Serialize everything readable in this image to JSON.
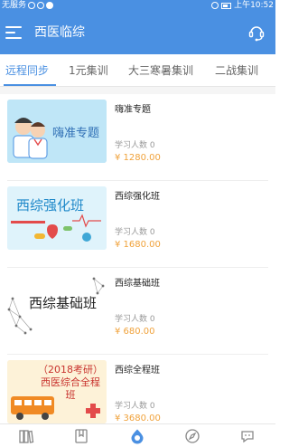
{
  "status_bar": {
    "carrier": "无服务",
    "time": "上午10:52"
  },
  "header": {
    "title": "西医临综"
  },
  "tabs": [
    {
      "label": "远程同步",
      "active": true
    },
    {
      "label": "1元集训",
      "active": false
    },
    {
      "label": "大三寒暑集训",
      "active": false
    },
    {
      "label": "二战集训",
      "active": false
    }
  ],
  "courses": [
    {
      "title": "嗨准专题",
      "count_label": "学习人数 0",
      "price": "¥ 1280.00",
      "thumb_text": "嗨准专题",
      "thumb_icon": "doctors-icon"
    },
    {
      "title": "西综强化班",
      "count_label": "学习人数 0",
      "price": "¥ 1680.00",
      "thumb_text": "西综强化班",
      "thumb_icon": "medicine-heart-icon"
    },
    {
      "title": "西综基础班",
      "count_label": "学习人数 0",
      "price": "¥ 680.00",
      "thumb_text": "西综基础班",
      "thumb_icon": "network-icon"
    },
    {
      "title": "西综全程班",
      "count_label": "学习人数 0",
      "price": "¥ 3680.00",
      "thumb_text": "（2018考研）西医综合全程班",
      "thumb_icon": "bus-icon"
    }
  ],
  "bottom_nav": [
    {
      "icon": "books-icon"
    },
    {
      "icon": "bookmark-icon"
    },
    {
      "icon": "home-drop-icon"
    },
    {
      "icon": "compass-icon"
    },
    {
      "icon": "chat-icon"
    }
  ],
  "colors": {
    "primary": "#4a90e2",
    "price": "#f0a23b",
    "text": "#222222",
    "muted": "#999999"
  }
}
